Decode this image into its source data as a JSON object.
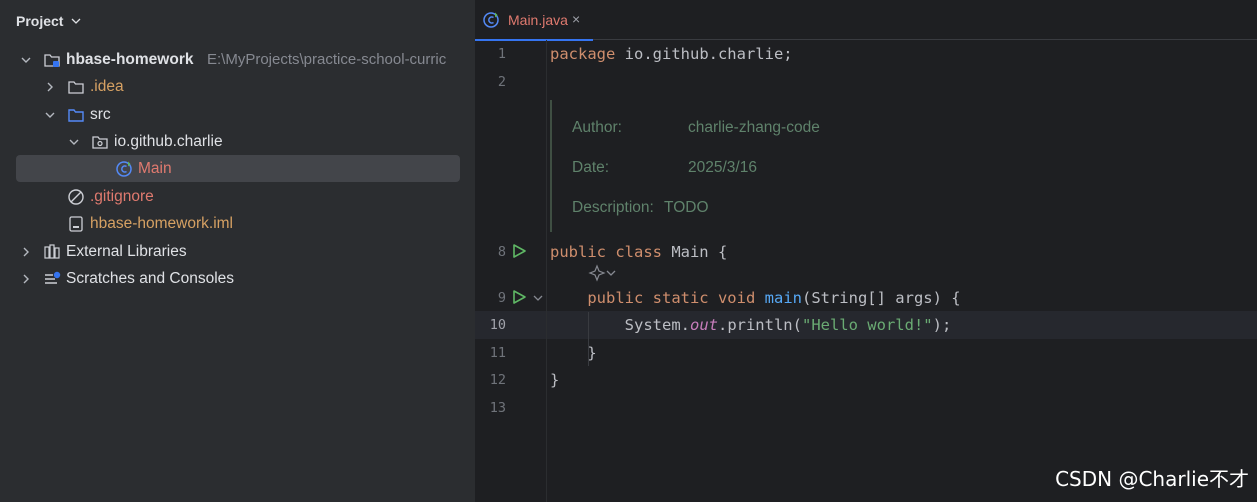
{
  "project_panel": {
    "title": "Project",
    "tree": [
      {
        "label": "hbase-homework",
        "path": "E:\\MyProjects\\practice-school-curric",
        "icon": "module-folder-icon"
      },
      {
        "label": ".idea",
        "icon": "folder-icon"
      },
      {
        "label": "src",
        "icon": "source-folder-icon"
      },
      {
        "label": "io.github.charlie",
        "icon": "package-icon"
      },
      {
        "label": "Main",
        "icon": "java-class-icon"
      },
      {
        "label": ".gitignore",
        "icon": "ignore-file-icon"
      },
      {
        "label": "hbase-homework.iml",
        "icon": "iml-file-icon"
      },
      {
        "label": "External Libraries",
        "icon": "libraries-icon"
      },
      {
        "label": "Scratches and Consoles",
        "icon": "scratches-icon"
      }
    ]
  },
  "editor": {
    "tab": {
      "label": "Main.java",
      "close": "×"
    },
    "line_numbers": [
      "1",
      "2",
      "8",
      "9",
      "10",
      "11",
      "12",
      "13"
    ],
    "code": {
      "l1_kw": "package",
      "l1_rest": " io.github.charlie;",
      "l8_kw": "public class",
      "l8_rest": " Main {",
      "l9_kw": "public static void",
      "l9_fn": "main",
      "l9_rest": "(String[] args) {",
      "l10_a": "System.",
      "l10_field": "out",
      "l10_b": ".println(",
      "l10_str": "\"Hello world!\"",
      "l10_c": ");",
      "l11": "}",
      "l12": "}"
    },
    "doc": {
      "author_label": "Author:",
      "author_value": "charlie-zhang-code",
      "date_label": "Date:",
      "date_value": "2025/3/16",
      "description_label": "Description:",
      "description_value": "TODO"
    }
  },
  "watermark": "CSDN @Charlie不才",
  "colors": {
    "keyword": "#cf8e6d",
    "function": "#56a8f5",
    "string": "#6aab73",
    "doc": "#5f826b",
    "accent": "#3574f0",
    "modified_file": "#e07a6f",
    "excluded_file": "#d6a163"
  }
}
